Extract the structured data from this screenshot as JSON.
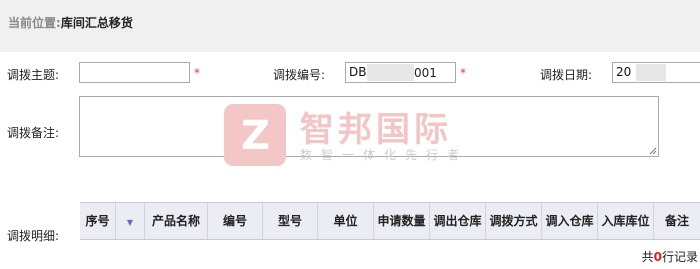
{
  "breadcrumb": {
    "label": "当前位置:",
    "page": "库间汇总移货"
  },
  "form": {
    "subject_label": "调拨主题:",
    "subject_value": "",
    "number_label": "调拨编号:",
    "number_prefix": "DB",
    "number_suffix": "001",
    "date_label": "调拨日期:",
    "date_prefix": "20",
    "remark_label": "调拨备注:",
    "remark_value": "",
    "required_mark": "*"
  },
  "watermark": {
    "logo_letter": "Z",
    "name": "智邦国际",
    "slogan": "数智一体化先行者"
  },
  "detail": {
    "label": "调拨明细:",
    "columns": [
      "序号",
      "",
      "产品名称",
      "编号",
      "型号",
      "单位",
      "申请数量",
      "调出仓库",
      "调拨方式",
      "调入仓库",
      "入库库位",
      "备注"
    ],
    "sort_icon": "▼"
  },
  "footer": {
    "prefix": "共",
    "count": "0",
    "suffix": "行记录"
  },
  "colors": {
    "required": "#e53a3a",
    "header_bg": "#ececf4",
    "count": "#e02020"
  }
}
